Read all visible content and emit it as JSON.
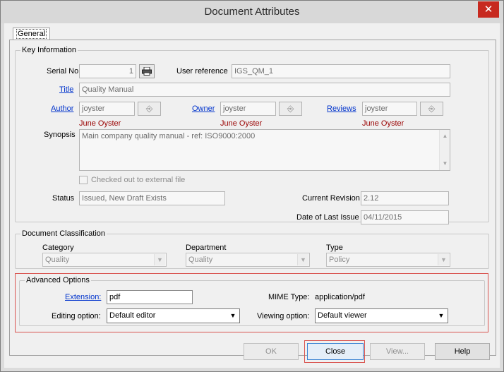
{
  "window": {
    "title": "Document Attributes",
    "close_glyph": "✕"
  },
  "tabs": [
    {
      "label": "General"
    }
  ],
  "key_information": {
    "legend": "Key Information",
    "serial_no": {
      "label": "Serial No",
      "value": "1"
    },
    "user_reference": {
      "label": "User reference",
      "value": "IGS_QM_1"
    },
    "title": {
      "label": "Title",
      "value": "Quality Manual"
    },
    "author": {
      "label": "Author",
      "value": "joyster",
      "name": "June Oyster"
    },
    "owner": {
      "label": "Owner",
      "value": "joyster",
      "name": "June Oyster"
    },
    "reviews": {
      "label": "Reviews",
      "value": "joyster",
      "name": "June Oyster"
    },
    "synopsis": {
      "label": "Synopsis",
      "value": "Main company quality manual - ref: ISO9000:2000"
    },
    "checked_out": {
      "label": "Checked out to external file",
      "checked": false
    },
    "status": {
      "label": "Status",
      "value": "Issued, New Draft Exists"
    },
    "current_revision": {
      "label": "Current Revision",
      "value": "2.12"
    },
    "date_of_last_issue": {
      "label": "Date of Last Issue",
      "value": "04/11/2015"
    }
  },
  "document_classification": {
    "legend": "Document Classification",
    "category": {
      "label": "Category",
      "value": "Quality"
    },
    "department": {
      "label": "Department",
      "value": "Quality"
    },
    "type": {
      "label": "Type",
      "value": "Policy"
    }
  },
  "advanced_options": {
    "legend": "Advanced Options",
    "extension": {
      "label": "Extension:",
      "value": "pdf"
    },
    "mime_type": {
      "label": "MIME Type:",
      "value": "application/pdf"
    },
    "editing_option": {
      "label": "Editing option:",
      "value": "Default editor"
    },
    "viewing_option": {
      "label": "Viewing option:",
      "value": "Default viewer"
    }
  },
  "buttons": {
    "ok": "OK",
    "close": "Close",
    "view": "View...",
    "help": "Help"
  },
  "icons": {
    "print": "printer-icon",
    "picker": "user-picker-icon",
    "dropdown_glyph": "▼",
    "scroll_up_glyph": "▲",
    "scroll_down_glyph": "▼"
  },
  "colors": {
    "link": "#0033cc",
    "user_name": "#990000",
    "highlight": "#d9534f",
    "title_close": "#c7291f"
  }
}
